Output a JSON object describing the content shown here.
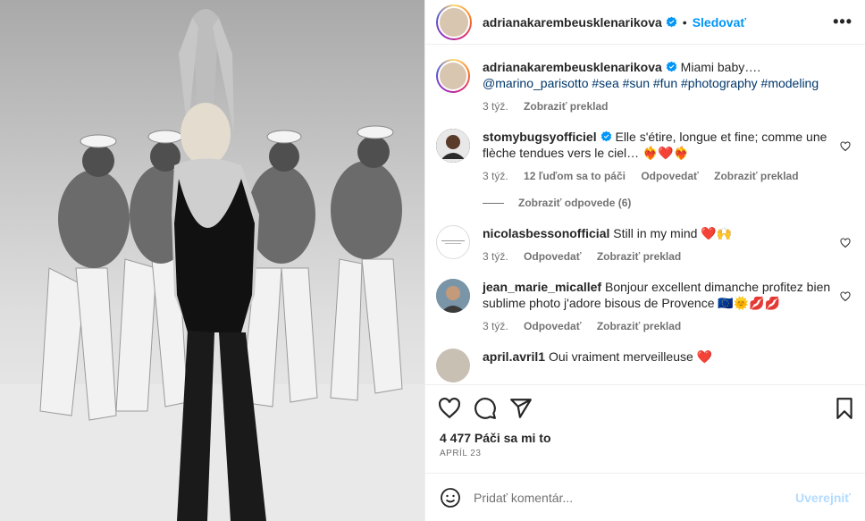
{
  "header": {
    "username": "adrianakarembeusklenarikova",
    "separator": "•",
    "follow_label": "Sledovať",
    "more_label": "•••"
  },
  "caption": {
    "username": "adrianakarembeusklenarikova",
    "text": "Miami baby….",
    "tags": "@marino_parisotto #sea #sun #fun #photography #modeling",
    "time": "3 týž.",
    "translate": "Zobraziť preklad"
  },
  "comments": [
    {
      "username": "stomybugsyofficiel",
      "text": "Elle s'étire, longue et fine; comme une flèche tendues vers le ciel… ❤️‍🔥❤️❤️‍🔥",
      "time": "3 týž.",
      "likes": "12 ľuďom sa to páči",
      "reply": "Odpovedať",
      "translate": "Zobraziť preklad",
      "view_replies": "Zobraziť odpovede (6)"
    },
    {
      "username": "nicolasbessonofficial",
      "text": "Still in my mind ❤️🙌",
      "time": "3 týž.",
      "reply": "Odpovedať",
      "translate": "Zobraziť preklad"
    },
    {
      "username": "jean_marie_micallef",
      "text": "Bonjour excellent dimanche profitez bien sublime photo j'adore bisous de Provence 🇪🇺🌞💋💋",
      "time": "3 týž.",
      "reply": "Odpovedať",
      "translate": "Zobraziť preklad"
    },
    {
      "username": "april.avril1",
      "text": "Oui vraiment merveilleuse ❤️"
    }
  ],
  "stats": {
    "likes": "4 477 Páči sa mi to",
    "date": "APRÍL 23"
  },
  "add_comment": {
    "placeholder": "Pridať komentár...",
    "post_label": "Uverejniť"
  },
  "colors": {
    "accent": "#0095f6",
    "text": "#262626",
    "muted": "#737373",
    "post_disabled": "#b3dbff"
  }
}
